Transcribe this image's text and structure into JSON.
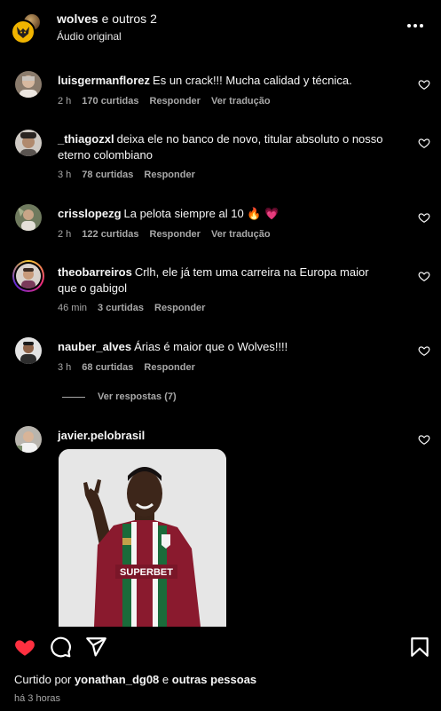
{
  "header": {
    "title_user": "wolves",
    "title_rest": "e outros 2",
    "subtitle": "Áudio original"
  },
  "comments": [
    {
      "username": "luisgermanflorez",
      "text": "Es un crack!!! Mucha calidad y técnica.",
      "time": "2 h",
      "likes": "170 curtidas",
      "reply": "Responder",
      "translate": "Ver tradução"
    },
    {
      "username": "_thiagozxl",
      "text": "deixa ele no banco de novo, titular absoluto o nosso eterno colombiano",
      "time": "3 h",
      "likes": "78 curtidas",
      "reply": "Responder"
    },
    {
      "username": "crisslopezg",
      "text": "La pelota siempre al 10 🔥 💗",
      "time": "2 h",
      "likes": "122 curtidas",
      "reply": "Responder",
      "translate": "Ver tradução"
    },
    {
      "username": "theobarreiros",
      "text": "Crlh, ele já tem uma carreira na Europa maior que o gabigol",
      "time": "46 min",
      "likes": "3 curtidas",
      "reply": "Responder"
    },
    {
      "username": "nauber_alves",
      "text": "Árias é maior que o Wolves!!!!",
      "time": "3 h",
      "likes": "68 curtidas",
      "reply": "Responder"
    },
    {
      "username": "javier.pelobrasil",
      "text": ""
    }
  ],
  "view_replies": "Ver respostas (7)",
  "photo": {
    "jersey_text": "SUPERBET"
  },
  "liked_by": {
    "prefix": "Curtido por",
    "user": "yonathan_dg08",
    "conj": "e",
    "others": "outras pessoas"
  },
  "time_ago": "há 3 horas",
  "colors": {
    "heart_red": "#ff3040",
    "muted": "#a8a8a8",
    "background": "#000000"
  },
  "icons": [
    "more-icon",
    "heart-icon",
    "comment-icon",
    "share-icon",
    "save-icon"
  ]
}
